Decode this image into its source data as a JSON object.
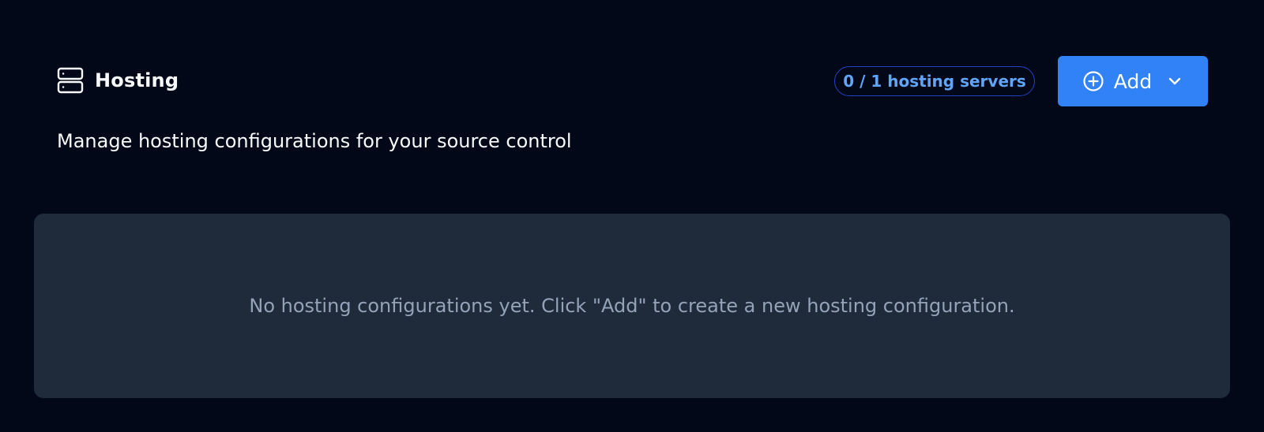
{
  "header": {
    "title": "Hosting",
    "icon": "server-icon"
  },
  "subtitle": "Manage hosting configurations for your source control",
  "badge": {
    "text": "0 / 1 hosting servers"
  },
  "add_button": {
    "label": "Add",
    "icon": "plus-circle-icon",
    "dropdown_icon": "chevron-down-icon"
  },
  "empty_state": {
    "message": "No hosting configurations yet. Click \"Add\" to create a new hosting configuration."
  },
  "colors": {
    "background": "#020817",
    "panel": "#1f2a3b",
    "accent": "#3182f6",
    "badge_text": "#60a5fa",
    "badge_border": "#2342c4",
    "muted_text": "#94a3b8"
  }
}
